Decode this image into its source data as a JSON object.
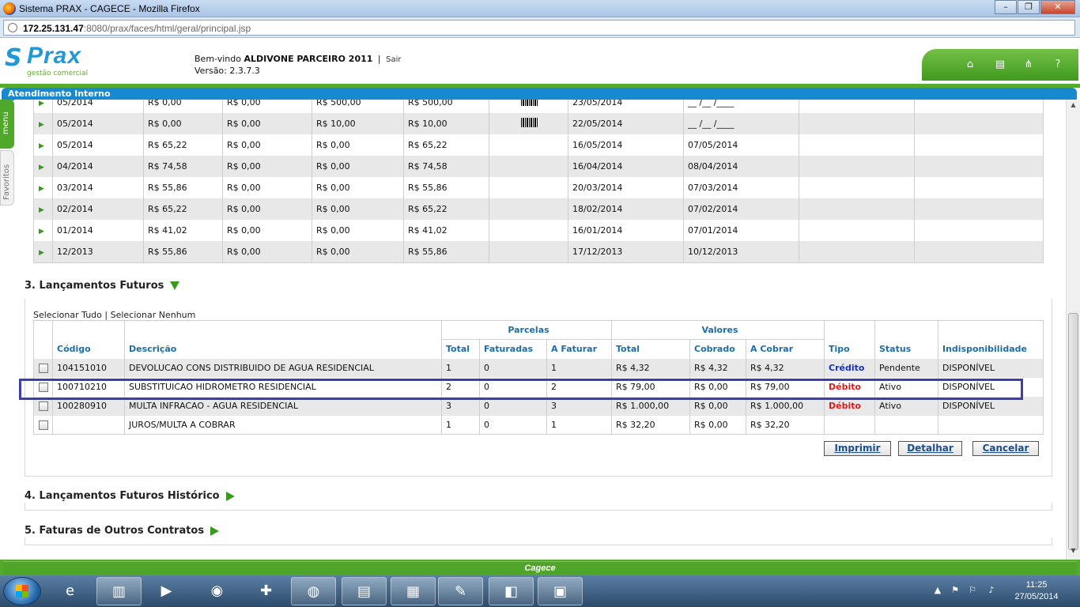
{
  "window": {
    "title": "Sistema PRAX - CAGECE - Mozilla Firefox",
    "url_host": "172.25.131.47",
    "url_rest": ":8080/prax/faces/html/geral/principal.jsp"
  },
  "header": {
    "logo_name": "Prax",
    "logo_tag": "gestão comercial",
    "welcome_prefix": "Bem-vindo",
    "user_name": "ALDIVONE PARCEIRO 2011",
    "separator": "|",
    "logout_label": "Sair",
    "version_label": "Versão: 2.3.7.3",
    "tools": [
      "home-icon",
      "printer-icon",
      "sitemap-icon",
      "help-icon"
    ],
    "help_label": "?"
  },
  "section_bar_title": "Atendimento Interno",
  "side": {
    "menu_label": "menu",
    "favorites_label": "Favoritos"
  },
  "upper_table": {
    "rows": [
      {
        "ref": "05/2014",
        "v1": "R$ 0,00",
        "v2": "R$ 0,00",
        "v3": "R$ 500,00",
        "v4": "R$ 500,00",
        "barcode": true,
        "venc": "23/05/2014",
        "pag": "__ /__ /____"
      },
      {
        "ref": "05/2014",
        "v1": "R$ 0,00",
        "v2": "R$ 0,00",
        "v3": "R$ 10,00",
        "v4": "R$ 10,00",
        "barcode": true,
        "venc": "22/05/2014",
        "pag": "__ /__ /____"
      },
      {
        "ref": "05/2014",
        "v1": "R$ 65,22",
        "v2": "R$ 0,00",
        "v3": "R$ 0,00",
        "v4": "R$ 65,22",
        "barcode": false,
        "venc": "16/05/2014",
        "pag": "07/05/2014"
      },
      {
        "ref": "04/2014",
        "v1": "R$ 74,58",
        "v2": "R$ 0,00",
        "v3": "R$ 0,00",
        "v4": "R$ 74,58",
        "barcode": false,
        "venc": "16/04/2014",
        "pag": "08/04/2014"
      },
      {
        "ref": "03/2014",
        "v1": "R$ 55,86",
        "v2": "R$ 0,00",
        "v3": "R$ 0,00",
        "v4": "R$ 55,86",
        "barcode": false,
        "venc": "20/03/2014",
        "pag": "07/03/2014"
      },
      {
        "ref": "02/2014",
        "v1": "R$ 65,22",
        "v2": "R$ 0,00",
        "v3": "R$ 0,00",
        "v4": "R$ 65,22",
        "barcode": false,
        "venc": "18/02/2014",
        "pag": "07/02/2014"
      },
      {
        "ref": "01/2014",
        "v1": "R$ 41,02",
        "v2": "R$ 0,00",
        "v3": "R$ 0,00",
        "v4": "R$ 41,02",
        "barcode": false,
        "venc": "16/01/2014",
        "pag": "07/01/2014"
      },
      {
        "ref": "12/2013",
        "v1": "R$ 55,86",
        "v2": "R$ 0,00",
        "v3": "R$ 0,00",
        "v4": "R$ 55,86",
        "barcode": false,
        "venc": "17/12/2013",
        "pag": "10/12/2013"
      }
    ]
  },
  "section3": {
    "title": "3. Lançamentos Futuros",
    "select_all": "Selecionar Tudo",
    "select_sep": "|",
    "select_none": "Selecionar Nenhum",
    "group_parcelas": "Parcelas",
    "group_valores": "Valores",
    "columns": [
      "Código",
      "Descrição",
      "Total",
      "Faturadas",
      "A Faturar",
      "Total",
      "Cobrado",
      "A Cobrar",
      "Tipo",
      "Status",
      "Indisponibilidade"
    ],
    "rows": [
      {
        "codigo": "104151010",
        "descricao": "DEVOLUCAO CONS DISTRIBUIDO DE AGUA RESIDENCIAL",
        "p_total": "1",
        "p_fat": "0",
        "p_afat": "1",
        "v_total": "R$ 4,32",
        "v_cob": "R$ 4,32",
        "v_acob": "R$ 4,32",
        "tipo": "Crédito",
        "tipo_kind": "credito",
        "status": "Pendente",
        "indisp": "DISPONÍVEL"
      },
      {
        "codigo": "100710210",
        "descricao": "SUBSTITUICAO HIDROMETRO RESIDENCIAL",
        "p_total": "2",
        "p_fat": "0",
        "p_afat": "2",
        "v_total": "R$ 79,00",
        "v_cob": "R$ 0,00",
        "v_acob": "R$ 79,00",
        "tipo": "Débito",
        "tipo_kind": "debito",
        "status": "Ativo",
        "indisp": "DISPONÍVEL"
      },
      {
        "codigo": "100280910",
        "descricao": "MULTA INFRACAO - AGUA RESIDENCIAL",
        "p_total": "3",
        "p_fat": "0",
        "p_afat": "3",
        "v_total": "R$ 1.000,00",
        "v_cob": "R$ 0,00",
        "v_acob": "R$ 1.000,00",
        "tipo": "Débito",
        "tipo_kind": "debito",
        "status": "Ativo",
        "indisp": "DISPONÍVEL"
      },
      {
        "codigo": "",
        "descricao": "JUROS/MULTA A COBRAR",
        "p_total": "1",
        "p_fat": "0",
        "p_afat": "1",
        "v_total": "R$ 32,20",
        "v_cob": "R$ 0,00",
        "v_acob": "R$ 32,20",
        "tipo": "",
        "tipo_kind": "",
        "status": "",
        "indisp": ""
      }
    ],
    "buttons": {
      "print": "Imprimir",
      "detail": "Detalhar",
      "cancel": "Cancelar"
    }
  },
  "section4": {
    "title": "4. Lançamentos Futuros Histórico"
  },
  "section5": {
    "title": "5. Faturas de Outros Contratos"
  },
  "footer": {
    "brand": "Cagece"
  },
  "taskbar": {
    "apps": [
      "internet-explorer-icon",
      "file-explorer-icon",
      "media-player-icon",
      "chrome-icon",
      "app-red-icon",
      "firefox-icon",
      "scanner-icon",
      "media-center-icon",
      "paint-icon",
      "virtualbox-icon",
      "office-icon"
    ],
    "time": "11:25",
    "date": "27/05/2014"
  },
  "colors": {
    "brand_blue": "#1789cf",
    "brand_green": "#55ab2e",
    "credito": "#1530c8",
    "debito": "#e01a1a",
    "header_text": "#1d6ea6",
    "highlight_box": "#3d3fae"
  }
}
